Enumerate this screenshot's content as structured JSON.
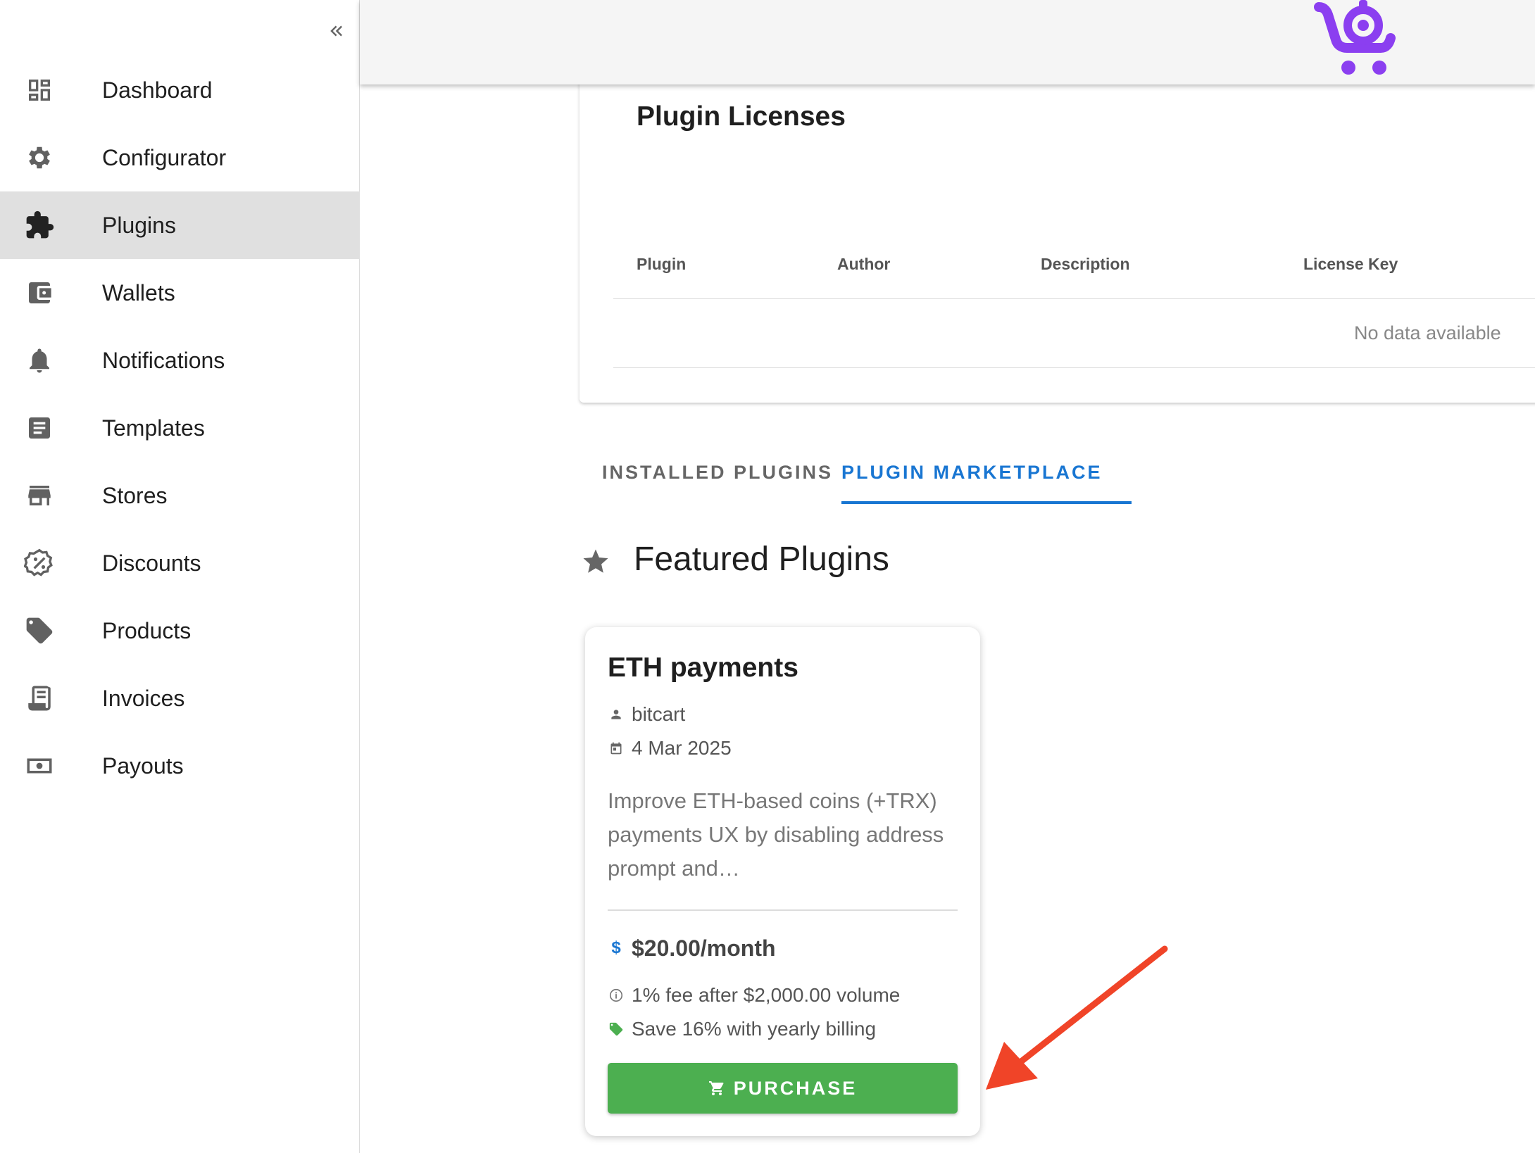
{
  "sidebar": {
    "items": [
      {
        "label": "Dashboard",
        "icon": "dashboard-icon"
      },
      {
        "label": "Configurator",
        "icon": "gear-icon"
      },
      {
        "label": "Plugins",
        "icon": "puzzle-icon",
        "active": true
      },
      {
        "label": "Wallets",
        "icon": "wallet-icon"
      },
      {
        "label": "Notifications",
        "icon": "bell-icon"
      },
      {
        "label": "Templates",
        "icon": "document-icon"
      },
      {
        "label": "Stores",
        "icon": "store-icon"
      },
      {
        "label": "Discounts",
        "icon": "discount-badge-icon"
      },
      {
        "label": "Products",
        "icon": "tag-icon"
      },
      {
        "label": "Invoices",
        "icon": "receipt-icon"
      },
      {
        "label": "Payouts",
        "icon": "cash-icon"
      }
    ]
  },
  "licenses": {
    "title": "Plugin Licenses",
    "columns": [
      "Plugin",
      "Author",
      "Description",
      "License Key"
    ],
    "empty_text": "No data available"
  },
  "tabs": {
    "installed": "INSTALLED PLUGINS",
    "marketplace": "PLUGIN MARKETPLACE",
    "active": "marketplace"
  },
  "featured": {
    "title": "Featured Plugins"
  },
  "plugin_card": {
    "title": "ETH payments",
    "author": "bitcart",
    "date": "4 Mar 2025",
    "description": "Improve ETH-based coins (+TRX) payments UX by disabling address prompt and…",
    "price_symbol": "$",
    "price": "$20.00/month",
    "fee_note": "1% fee after $2,000.00 volume",
    "save_note": "Save 16% with yearly billing",
    "purchase_label": "PURCHASE"
  },
  "colors": {
    "accent": "#1976d2",
    "purchase": "#4caf50",
    "logo": "#8b3ff0",
    "annotation": "#f04428"
  }
}
